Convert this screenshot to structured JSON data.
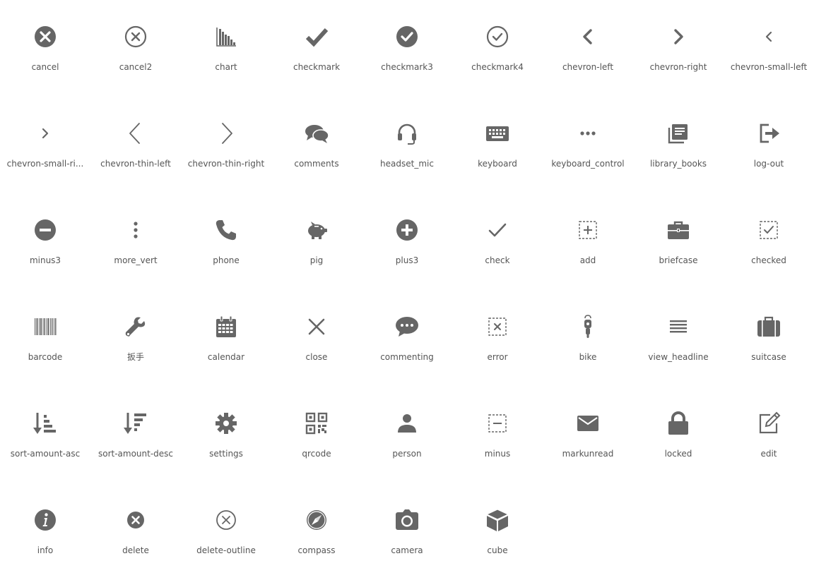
{
  "icon_color": "#666666",
  "label_color": "#555555",
  "icons": [
    {
      "label": "cancel",
      "icon": "cancel"
    },
    {
      "label": "cancel2",
      "icon": "cancel2"
    },
    {
      "label": "chart",
      "icon": "chart"
    },
    {
      "label": "checkmark",
      "icon": "checkmark"
    },
    {
      "label": "checkmark3",
      "icon": "checkmark3"
    },
    {
      "label": "checkmark4",
      "icon": "checkmark4"
    },
    {
      "label": "chevron-left",
      "icon": "chevron-left"
    },
    {
      "label": "chevron-right",
      "icon": "chevron-right"
    },
    {
      "label": "chevron-small-left",
      "icon": "chevron-small-left"
    },
    {
      "label": "chevron-small-ri...",
      "icon": "chevron-small-right"
    },
    {
      "label": "chevron-thin-left",
      "icon": "chevron-thin-left"
    },
    {
      "label": "chevron-thin-right",
      "icon": "chevron-thin-right"
    },
    {
      "label": "comments",
      "icon": "comments"
    },
    {
      "label": "headset_mic",
      "icon": "headset-mic"
    },
    {
      "label": "keyboard",
      "icon": "keyboard"
    },
    {
      "label": "keyboard_control",
      "icon": "keyboard-control"
    },
    {
      "label": "library_books",
      "icon": "library-books"
    },
    {
      "label": "log-out",
      "icon": "log-out"
    },
    {
      "label": "minus3",
      "icon": "minus3"
    },
    {
      "label": "more_vert",
      "icon": "more-vert"
    },
    {
      "label": "phone",
      "icon": "phone"
    },
    {
      "label": "pig",
      "icon": "pig"
    },
    {
      "label": "plus3",
      "icon": "plus3"
    },
    {
      "label": "check",
      "icon": "check"
    },
    {
      "label": "add",
      "icon": "add"
    },
    {
      "label": "briefcase",
      "icon": "briefcase"
    },
    {
      "label": "checked",
      "icon": "checked"
    },
    {
      "label": "barcode",
      "icon": "barcode"
    },
    {
      "label": "扳手",
      "icon": "wrench"
    },
    {
      "label": "calendar",
      "icon": "calendar"
    },
    {
      "label": "close",
      "icon": "close"
    },
    {
      "label": "commenting",
      "icon": "commenting"
    },
    {
      "label": "error",
      "icon": "error"
    },
    {
      "label": "bike",
      "icon": "bike"
    },
    {
      "label": "view_headline",
      "icon": "view-headline"
    },
    {
      "label": "suitcase",
      "icon": "suitcase"
    },
    {
      "label": "sort-amount-asc",
      "icon": "sort-amount-asc"
    },
    {
      "label": "sort-amount-desc",
      "icon": "sort-amount-desc"
    },
    {
      "label": "settings",
      "icon": "settings"
    },
    {
      "label": "qrcode",
      "icon": "qrcode"
    },
    {
      "label": "person",
      "icon": "person"
    },
    {
      "label": "minus",
      "icon": "minus"
    },
    {
      "label": "markunread",
      "icon": "markunread"
    },
    {
      "label": "locked",
      "icon": "locked"
    },
    {
      "label": "edit",
      "icon": "edit"
    },
    {
      "label": "info",
      "icon": "info"
    },
    {
      "label": "delete",
      "icon": "delete"
    },
    {
      "label": "delete-outline",
      "icon": "delete-outline"
    },
    {
      "label": "compass",
      "icon": "compass"
    },
    {
      "label": "camera",
      "icon": "camera"
    },
    {
      "label": "cube",
      "icon": "cube"
    }
  ]
}
